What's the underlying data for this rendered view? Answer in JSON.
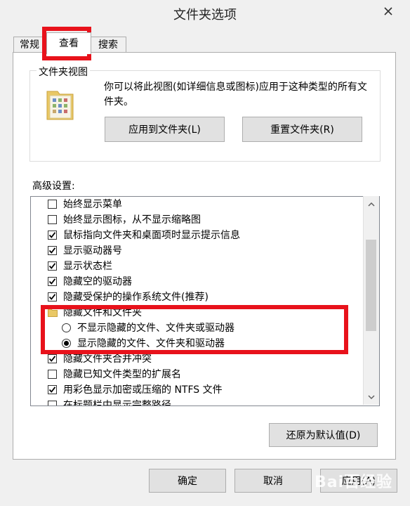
{
  "window": {
    "title": "文件夹选项"
  },
  "tabs": [
    {
      "label": "常规",
      "active": false
    },
    {
      "label": "查看",
      "active": true
    },
    {
      "label": "搜索",
      "active": false
    }
  ],
  "folder_view": {
    "legend": "文件夹视图",
    "description": "你可以将此视图(如详细信息或图标)应用于这种类型的所有文件夹。",
    "apply_button": "应用到文件夹(L)",
    "reset_button": "重置文件夹(R)"
  },
  "advanced": {
    "label": "高级设置:",
    "items": [
      {
        "type": "checkbox",
        "checked": false,
        "label": "始终显示菜单"
      },
      {
        "type": "checkbox",
        "checked": false,
        "label": "始终显示图标，从不显示缩略图"
      },
      {
        "type": "checkbox",
        "checked": true,
        "label": "鼠标指向文件夹和桌面项时显示提示信息"
      },
      {
        "type": "checkbox",
        "checked": true,
        "label": "显示驱动器号"
      },
      {
        "type": "checkbox",
        "checked": true,
        "label": "显示状态栏"
      },
      {
        "type": "checkbox",
        "checked": true,
        "label": "隐藏空的驱动器"
      },
      {
        "type": "checkbox",
        "checked": true,
        "label": "隐藏受保护的操作系统文件(推荐)"
      },
      {
        "type": "folder",
        "label": "隐藏文件和文件夹"
      },
      {
        "type": "radio",
        "checked": false,
        "label": "不显示隐藏的文件、文件夹或驱动器"
      },
      {
        "type": "radio",
        "checked": true,
        "label": "显示隐藏的文件、文件夹和驱动器"
      },
      {
        "type": "checkbox",
        "checked": true,
        "label": "隐藏文件夹合并冲突"
      },
      {
        "type": "checkbox",
        "checked": false,
        "label": "隐藏已知文件类型的扩展名"
      },
      {
        "type": "checkbox",
        "checked": true,
        "label": "用彩色显示加密或压缩的 NTFS 文件"
      },
      {
        "type": "checkbox",
        "checked": false,
        "label": "在标题栏中显示完整路径"
      }
    ]
  },
  "restore_defaults_button": "还原为默认值(D)",
  "footer": {
    "ok": "确定",
    "cancel": "取消",
    "apply": "应用(A)"
  },
  "watermark": "Bai百经验",
  "colors": {
    "highlight_box": "#e8121b",
    "button_face": "#e1e1e1",
    "dialog_bg": "#f0f0f0"
  },
  "icons": {
    "close": "close-icon",
    "folder_view": "folder-view-icon",
    "folder_small": "folder-icon",
    "scroll_up": "chevron-up-icon",
    "scroll_down": "chevron-down-icon"
  }
}
